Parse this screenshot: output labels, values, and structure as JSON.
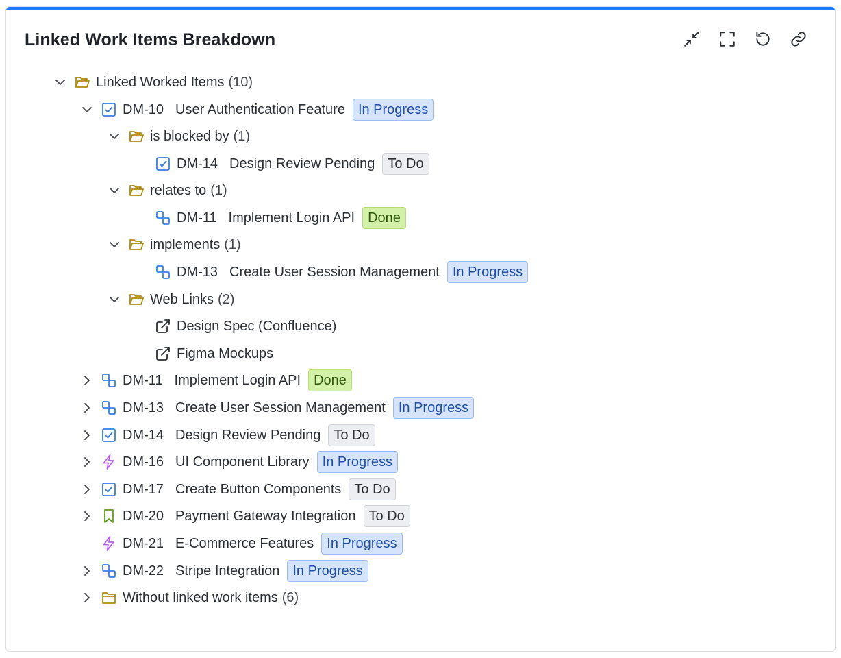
{
  "header": {
    "title": "Linked Work Items Breakdown"
  },
  "toolbar": [
    {
      "name": "collapse-icon",
      "label": "Collapse"
    },
    {
      "name": "fullscreen-icon",
      "label": "Fullscreen"
    },
    {
      "name": "refresh-icon",
      "label": "Refresh"
    },
    {
      "name": "link-icon",
      "label": "Copy link"
    }
  ],
  "colors": {
    "accent": "#1d7afc",
    "folder": "#b08a0c",
    "task": "#357de8",
    "subtask": "#357de8",
    "epic": "#b65cf4",
    "story": "#5f9c1f"
  },
  "tree": {
    "root": {
      "label": "Linked Worked Items",
      "count": "(10)"
    },
    "dm10": {
      "key": "DM-10",
      "summary": "User Authentication Feature",
      "status": "In Progress"
    },
    "blocked": {
      "label": "is blocked by",
      "count": "(1)"
    },
    "blocked_item": {
      "key": "DM-14",
      "summary": "Design Review Pending",
      "status": "To Do"
    },
    "relates": {
      "label": "relates to",
      "count": "(1)"
    },
    "relates_item": {
      "key": "DM-11",
      "summary": "Implement Login API",
      "status": "Done"
    },
    "implements": {
      "label": "implements",
      "count": "(1)"
    },
    "implements_item": {
      "key": "DM-13",
      "summary": "Create User Session Management",
      "status": "In Progress"
    },
    "weblinks": {
      "label": "Web Links",
      "count": "(2)"
    },
    "link1": "Design Spec (Confluence)",
    "link2": "Figma Mockups",
    "items": [
      {
        "key": "DM-11",
        "summary": "Implement Login API",
        "status": "Done",
        "type": "subtask-icon"
      },
      {
        "key": "DM-13",
        "summary": "Create User Session Management",
        "status": "In Progress",
        "type": "subtask-icon"
      },
      {
        "key": "DM-14",
        "summary": "Design Review Pending",
        "status": "To Do",
        "type": "task-icon"
      },
      {
        "key": "DM-16",
        "summary": "UI Component Library",
        "status": "In Progress",
        "type": "epic-icon"
      },
      {
        "key": "DM-17",
        "summary": "Create Button Components",
        "status": "To Do",
        "type": "task-icon"
      },
      {
        "key": "DM-20",
        "summary": "Payment Gateway Integration",
        "status": "To Do",
        "type": "story-icon"
      },
      {
        "key": "DM-21",
        "summary": "E-Commerce Features",
        "status": "In Progress",
        "type": "epic-icon"
      },
      {
        "key": "DM-22",
        "summary": "Stripe Integration",
        "status": "In Progress",
        "type": "subtask-icon"
      }
    ],
    "without": {
      "label": "Without linked work items",
      "count": "(6)"
    }
  }
}
